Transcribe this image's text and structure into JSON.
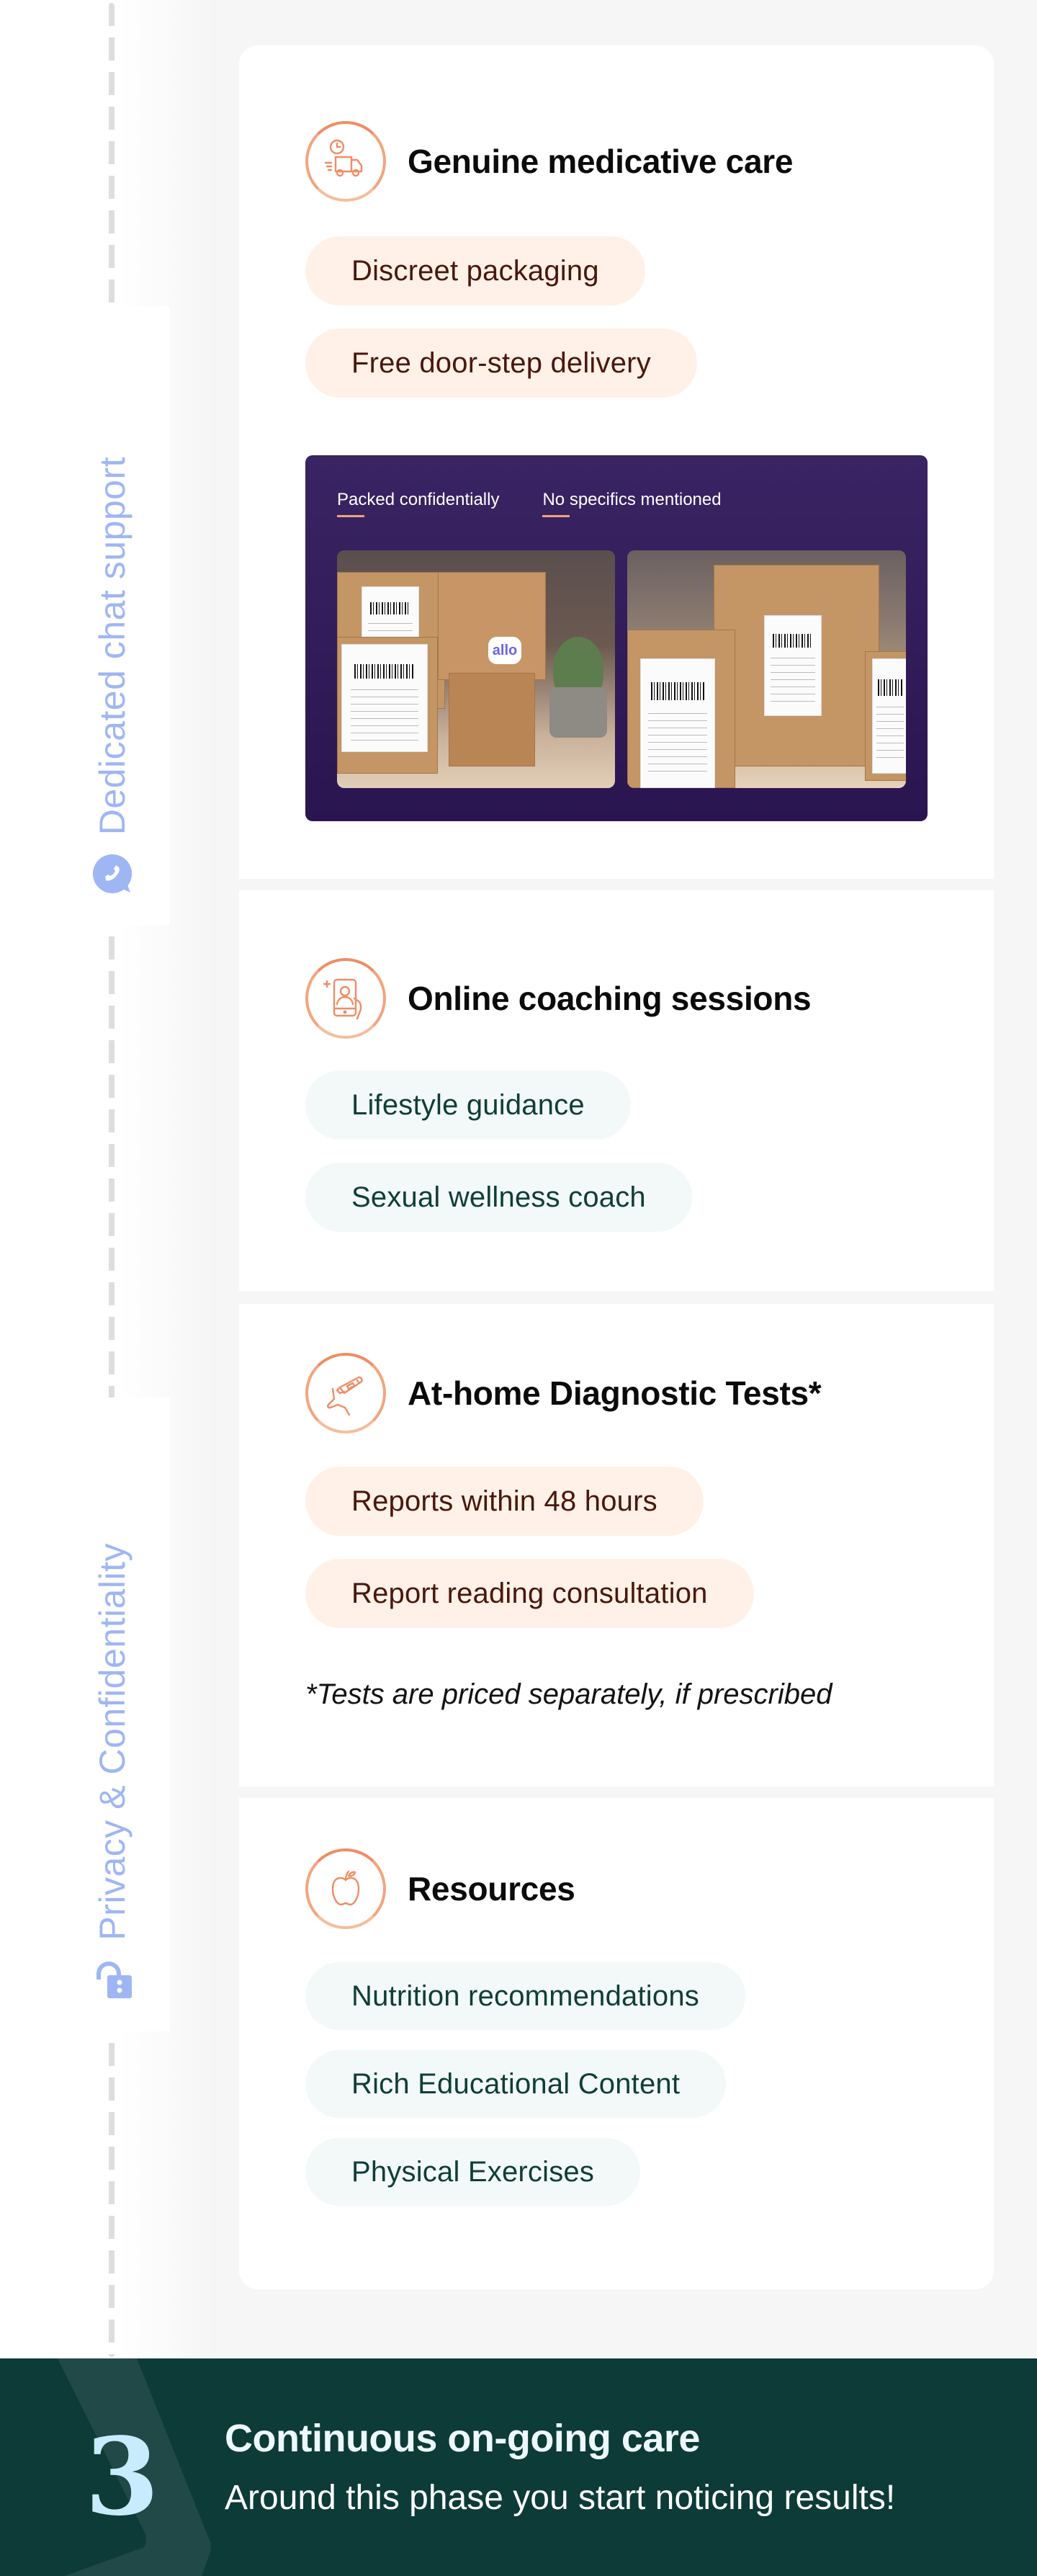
{
  "side_tabs": [
    {
      "label": "Dedicated chat support",
      "icon": "chat-phone-icon"
    },
    {
      "label": "Privacy & Confidentiality",
      "icon": "lock-icon"
    }
  ],
  "cards": [
    {
      "title": "Genuine medicative care",
      "icon": "delivery-truck-clock-icon",
      "chip_style": "peach",
      "chips": [
        "Discreet packaging",
        "Free door-step delivery"
      ],
      "banner": {
        "labels": [
          "Packed confidentially",
          "No specifics mentioned"
        ],
        "photo_logo": "allo"
      }
    },
    {
      "title": "Online coaching sessions",
      "icon": "phone-video-call-icon",
      "chip_style": "mint",
      "chips": [
        "Lifestyle guidance",
        "Sexual wellness coach"
      ]
    },
    {
      "title": "At-home Diagnostic Tests*",
      "icon": "test-kit-icon",
      "chip_style": "peach",
      "chips": [
        "Reports within 48 hours",
        "Report reading consultation"
      ],
      "footnote": "*Tests are priced separately, if prescribed"
    },
    {
      "title": "Resources",
      "icon": "apple-icon",
      "chip_style": "mint",
      "chips": [
        "Nutrition recommendations",
        "Rich Educational Content",
        "Physical Exercises"
      ]
    }
  ],
  "footer": {
    "step_number": "3",
    "title": "Continuous on-going care",
    "subtitle": "Around this phase you start noticing results!"
  },
  "colors": {
    "accent_orange": "#ef8d65",
    "side_tab_blue": "#9fb6f4",
    "peach_chip_bg": "#fff1e7",
    "mint_chip_bg": "#f3f9f8",
    "footer_bg": "#0d3b37",
    "banner_bg": "#2f1a58"
  }
}
